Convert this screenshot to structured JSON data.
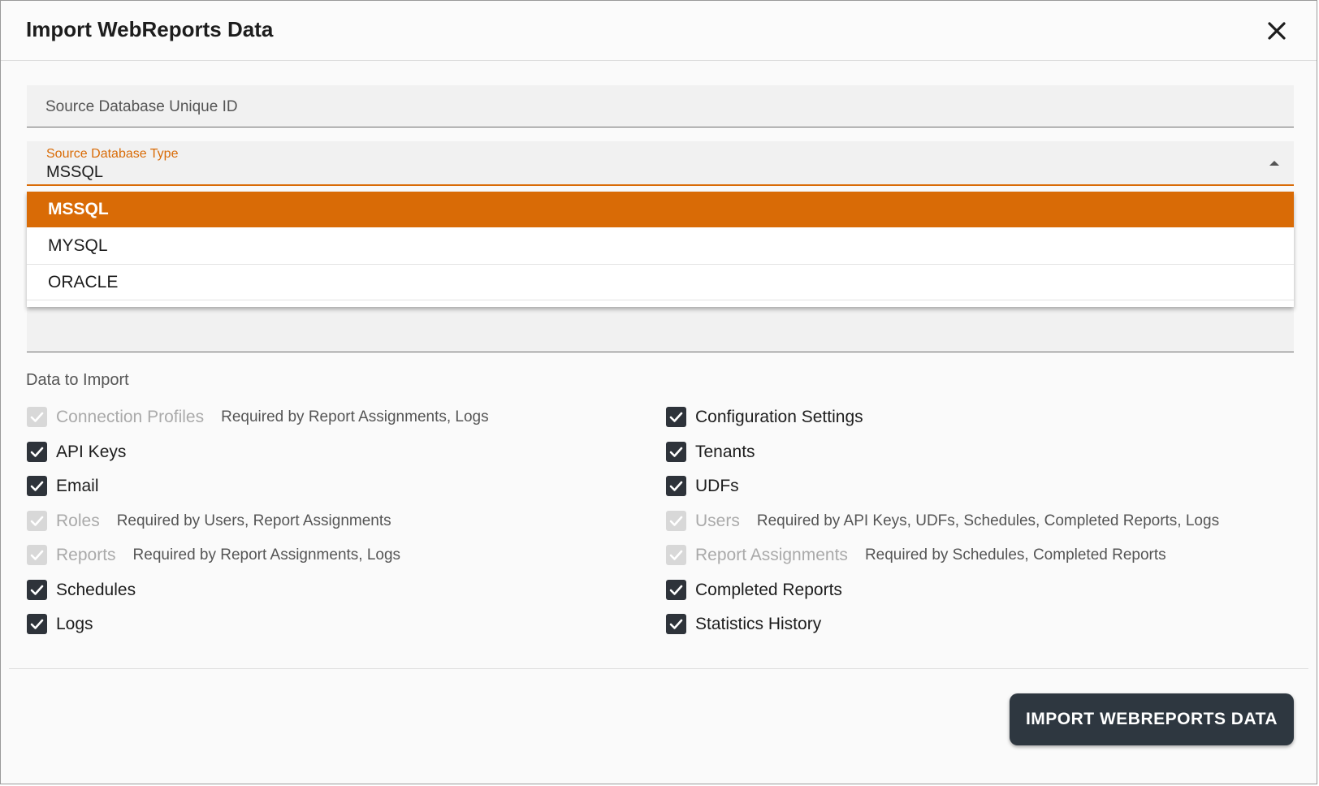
{
  "dialog": {
    "title": "Import WebReports Data",
    "close_icon": "close-icon"
  },
  "form": {
    "unique_id_placeholder": "Source Database Unique ID",
    "db_type_label": "Source Database Type",
    "db_type_value": "MSSQL",
    "db_type_options": [
      "MSSQL",
      "MYSQL",
      "ORACLE"
    ]
  },
  "import": {
    "section_label": "Data to Import",
    "left": [
      {
        "label": "Connection Profiles",
        "checked": true,
        "disabled": true,
        "note": "Required by Report Assignments, Logs"
      },
      {
        "label": "API Keys",
        "checked": true,
        "disabled": false,
        "note": ""
      },
      {
        "label": "Email",
        "checked": true,
        "disabled": false,
        "note": ""
      },
      {
        "label": "Roles",
        "checked": true,
        "disabled": true,
        "note": "Required by Users, Report Assignments"
      },
      {
        "label": "Reports",
        "checked": true,
        "disabled": true,
        "note": "Required by Report Assignments, Logs"
      },
      {
        "label": "Schedules",
        "checked": true,
        "disabled": false,
        "note": ""
      },
      {
        "label": "Logs",
        "checked": true,
        "disabled": false,
        "note": ""
      }
    ],
    "right": [
      {
        "label": "Configuration Settings",
        "checked": true,
        "disabled": false,
        "note": ""
      },
      {
        "label": "Tenants",
        "checked": true,
        "disabled": false,
        "note": ""
      },
      {
        "label": "UDFs",
        "checked": true,
        "disabled": false,
        "note": ""
      },
      {
        "label": "Users",
        "checked": true,
        "disabled": true,
        "note": "Required by API Keys, UDFs, Schedules, Completed Reports, Logs"
      },
      {
        "label": "Report Assignments",
        "checked": true,
        "disabled": true,
        "note": "Required by Schedules, Completed Reports"
      },
      {
        "label": "Completed Reports",
        "checked": true,
        "disabled": false,
        "note": ""
      },
      {
        "label": "Statistics History",
        "checked": true,
        "disabled": false,
        "note": ""
      }
    ]
  },
  "footer": {
    "submit_label": "IMPORT WEBREPORTS DATA"
  },
  "colors": {
    "accent": "#d96b06",
    "checkbox": "#2e333a",
    "button": "#2e3740"
  }
}
